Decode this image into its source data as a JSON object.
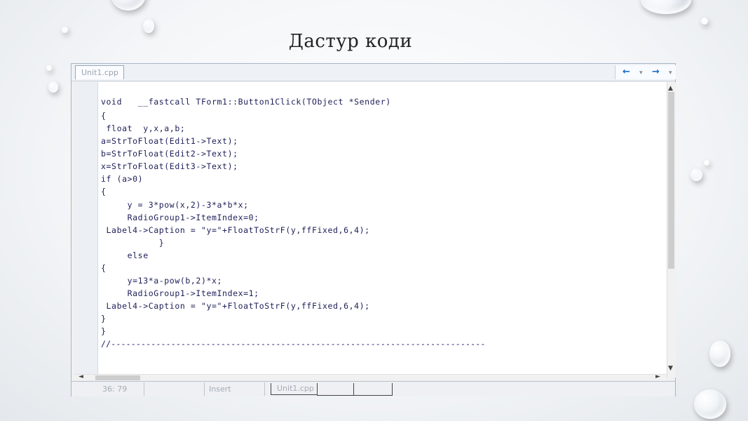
{
  "slide": {
    "title": "Дастур коди"
  },
  "ide": {
    "tab_label": "Unit1.cpp",
    "nav": {
      "back": "←",
      "forward": "→",
      "dropdown": "▾"
    },
    "code_lines": [
      "void   __fastcall TForm1::Button1Click(TObject *Sender)",
      "{",
      " float  y,x,a,b;",
      "a=StrToFloat(Edit1->Text);",
      "b=StrToFloat(Edit2->Text);",
      "x=StrToFloat(Edit3->Text);",
      "if (a>0)",
      "{",
      "     y = 3*pow(x,2)-3*a*b*x;",
      "     RadioGroup1->ItemIndex=0;",
      " Label4->Caption = \"y=\"+FloatToStrF(y,ffFixed,6,4);",
      "           }",
      "     else",
      "{",
      "     y=13*a-pow(b,2)*x;",
      "     RadioGroup1->ItemIndex=1;",
      " Label4->Caption = \"y=\"+FloatToStrF(y,ffFixed,6,4);",
      "}",
      "}",
      "//---------------------------------------------------------------------------"
    ],
    "status": {
      "position": "36: 79",
      "modified": "",
      "mode": "Insert",
      "tabs": [
        "Unit1.cpp",
        "",
        ""
      ]
    },
    "scroll": {
      "up": "▲",
      "down": "▼",
      "left": "◄",
      "right": "►"
    }
  }
}
